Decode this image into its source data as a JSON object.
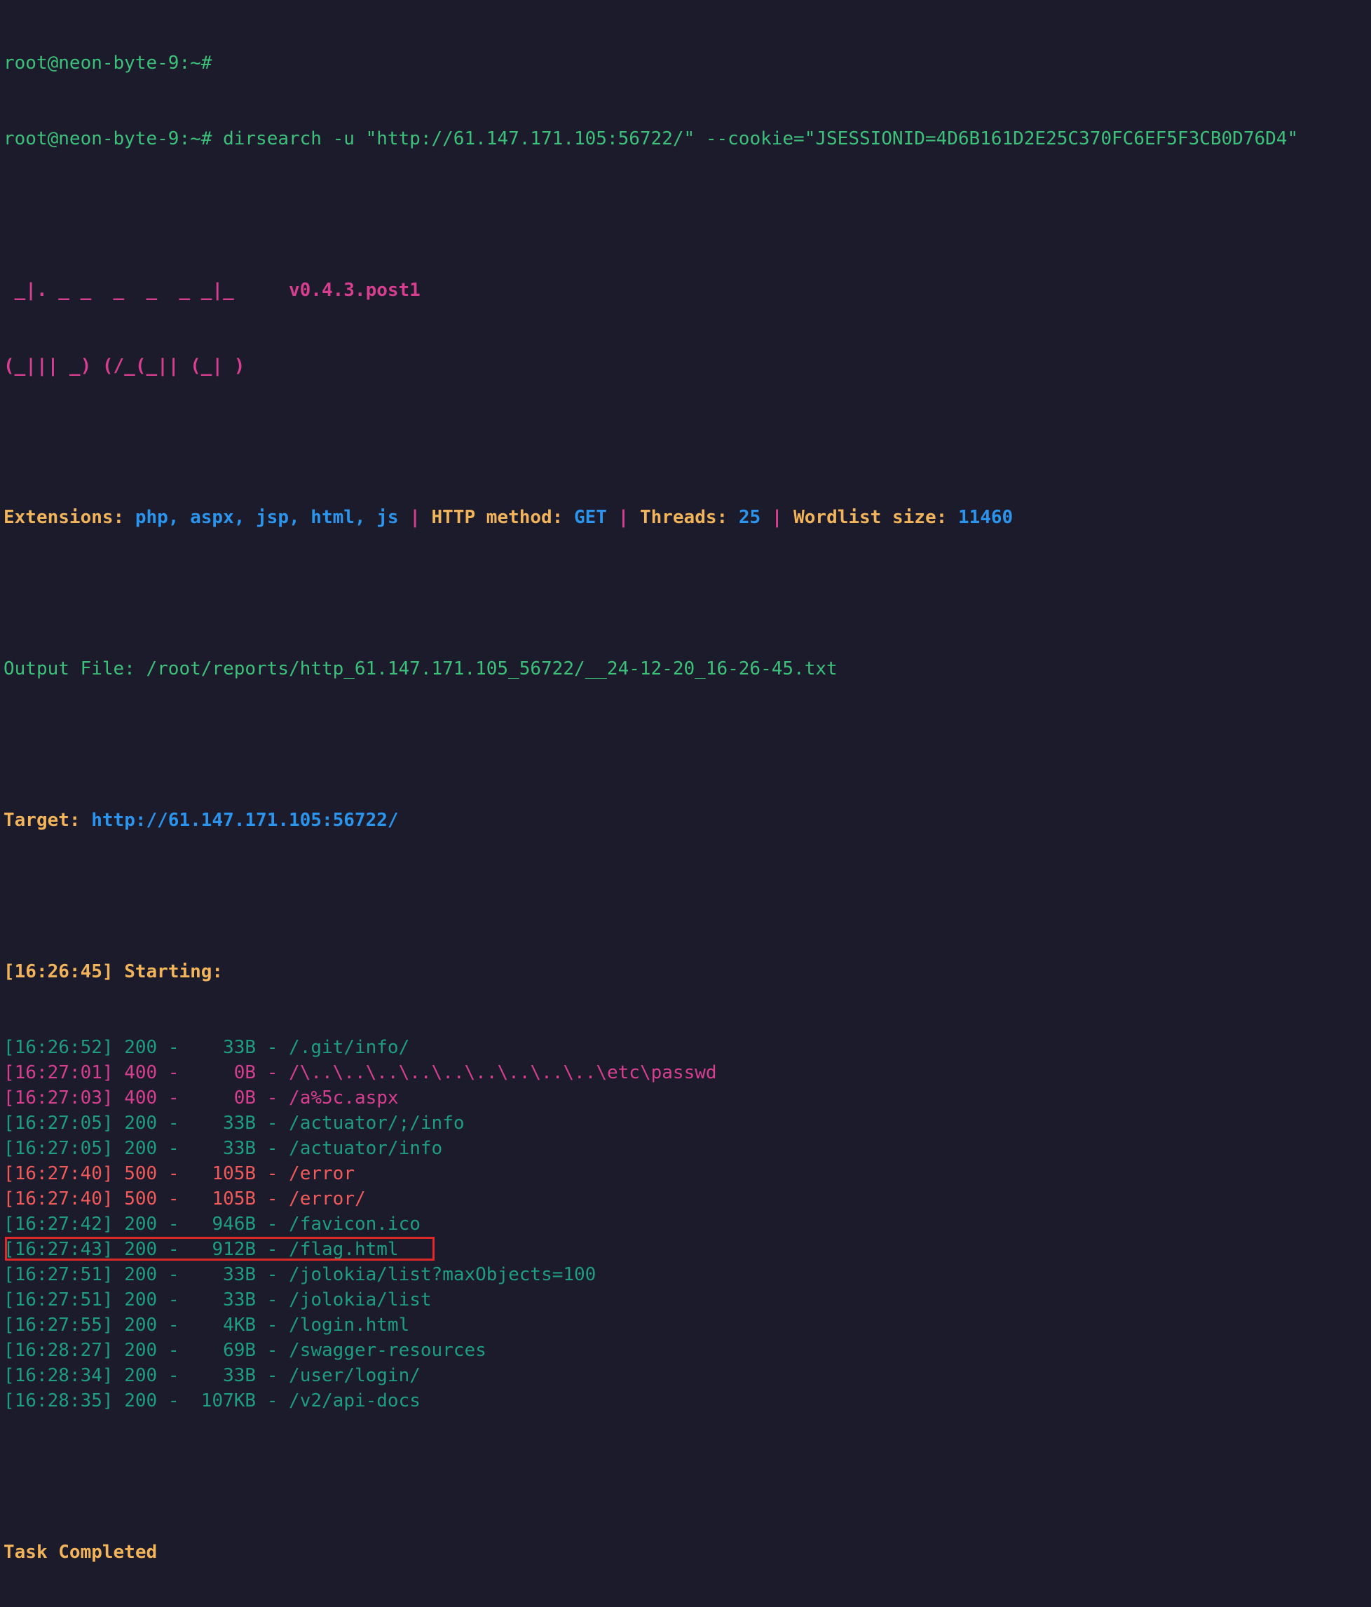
{
  "prompt": "root@neon-byte-9:~#",
  "command": "dirsearch -u \"http://61.147.171.105:56722/\" --cookie=\"JSESSIONID=4D6B161D2E25C370FC6EF5F3CB0D76D4\"",
  "banner": {
    "line1": " _|. _ _  _  _  _ _|_ ",
    "line2": "(_||| _) (/_(_|| (_| )",
    "version": "v0.4.3.post1"
  },
  "config": {
    "extensions_label": "Extensions:",
    "extensions_value": "php, aspx, jsp, html, js",
    "separator": "|",
    "method_label": "HTTP method:",
    "method_value": "GET",
    "threads_label": "Threads:",
    "threads_value": "25",
    "wordlist_label": "Wordlist size:",
    "wordlist_value": "11460"
  },
  "output_file": "Output File: /root/reports/http_61.147.171.105_56722/__24-12-20_16-26-45.txt",
  "target": {
    "label": "Target:",
    "url": "http://61.147.171.105:56722/"
  },
  "starting": {
    "time": "[16:26:45]",
    "text": "Starting:"
  },
  "results": [
    {
      "time": "[16:26:52]",
      "status": "200",
      "size": " 33B",
      "path": "/.git/info/",
      "color": "teal"
    },
    {
      "time": "[16:27:01]",
      "status": "400",
      "size": "  0B",
      "path": "/\\..\\..\\..\\..\\..\\..\\..\\..\\..\\etc\\passwd",
      "color": "pink"
    },
    {
      "time": "[16:27:03]",
      "status": "400",
      "size": "  0B",
      "path": "/a%5c.aspx",
      "color": "pink"
    },
    {
      "time": "[16:27:05]",
      "status": "200",
      "size": " 33B",
      "path": "/actuator/;/info",
      "color": "teal"
    },
    {
      "time": "[16:27:05]",
      "status": "200",
      "size": " 33B",
      "path": "/actuator/info",
      "color": "teal"
    },
    {
      "time": "[16:27:40]",
      "status": "500",
      "size": "105B",
      "path": "/error",
      "color": "red"
    },
    {
      "time": "[16:27:40]",
      "status": "500",
      "size": "105B",
      "path": "/error/",
      "color": "red"
    },
    {
      "time": "[16:27:42]",
      "status": "200",
      "size": "946B",
      "path": "/favicon.ico",
      "color": "teal"
    },
    {
      "time": "[16:27:43]",
      "status": "200",
      "size": "912B",
      "path": "/flag.html",
      "color": "teal",
      "highlight": true
    },
    {
      "time": "[16:27:51]",
      "status": "200",
      "size": " 33B",
      "path": "/jolokia/list?maxObjects=100",
      "color": "teal"
    },
    {
      "time": "[16:27:51]",
      "status": "200",
      "size": " 33B",
      "path": "/jolokia/list",
      "color": "teal"
    },
    {
      "time": "[16:27:55]",
      "status": "200",
      "size": "  4KB",
      "path": "/login.html",
      "color": "teal"
    },
    {
      "time": "[16:28:27]",
      "status": "200",
      "size": " 69B",
      "path": "/swagger-resources",
      "color": "teal"
    },
    {
      "time": "[16:28:34]",
      "status": "200",
      "size": " 33B",
      "path": "/user/login/",
      "color": "teal"
    },
    {
      "time": "[16:28:35]",
      "status": "200",
      "size": "107KB",
      "path": "/v2/api-docs",
      "color": "teal"
    }
  ],
  "task_completed": "Task Completed",
  "colors": {
    "background": "#1c1b2b",
    "prompt_green": "#3cc07a",
    "pink": "#d63f8f",
    "orange": "#f2b45b",
    "blue": "#2b95ee",
    "teal": "#1f9d80",
    "red": "#f05a5a",
    "highlight_box": "#e02a2a",
    "cursor": "#21c17a"
  }
}
